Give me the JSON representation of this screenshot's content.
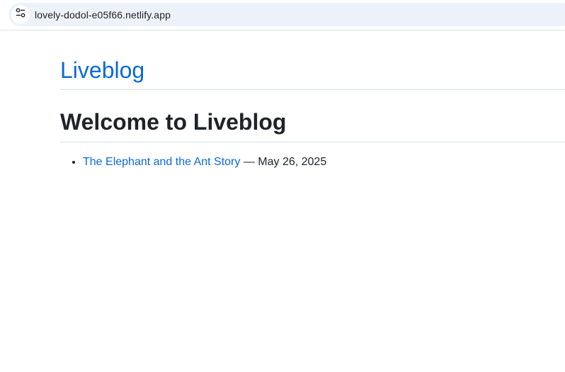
{
  "browser": {
    "url": "lovely-dodol-e05f66.netlify.app",
    "site_info_icon": "tune-icon"
  },
  "header": {
    "site_title": "Liveblog"
  },
  "main": {
    "title": "Welcome to Liveblog",
    "posts": [
      {
        "title": "The Elephant and the Ant Story",
        "separator": " — ",
        "date": "May 26, 2025"
      }
    ]
  },
  "colors": {
    "link": "#0969da",
    "text": "#1f2328",
    "rule": "#d8dee4",
    "address_bar": "#edf2fa"
  }
}
